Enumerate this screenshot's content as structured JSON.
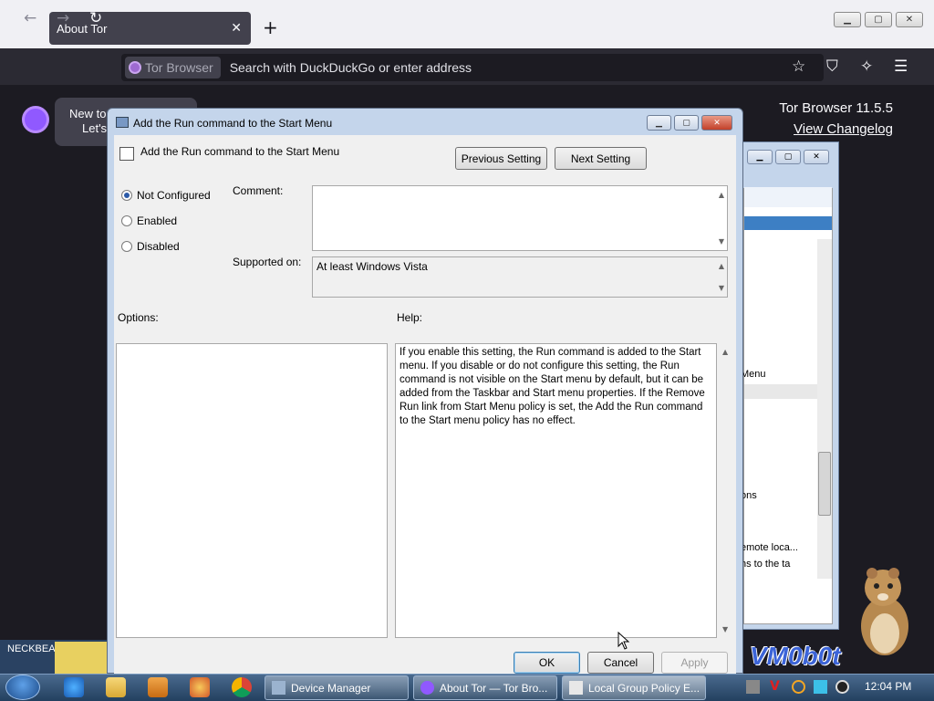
{
  "browser": {
    "tab_title": "About Tor",
    "tor_chip": "Tor Browser",
    "url_placeholder": "Search with DuckDuckGo or enter address"
  },
  "tor_page": {
    "banner_line1": "New to",
    "banner_line2": "Let's",
    "version": "Tor Browser 11.5.5",
    "changelog": "View Changelog"
  },
  "dialog": {
    "title": "Add the Run command to the Start Menu",
    "setting_name": "Add the Run command to the Start Menu",
    "prev_button": "Previous Setting",
    "next_button": "Next Setting",
    "radios": [
      {
        "label": "Not Configured",
        "checked": true
      },
      {
        "label": "Enabled",
        "checked": false
      },
      {
        "label": "Disabled",
        "checked": false
      }
    ],
    "comment_label": "Comment:",
    "supported_label": "Supported on:",
    "supported_value": "At least Windows Vista",
    "options_label": "Options:",
    "help_label": "Help:",
    "help_text": "If you enable this setting, the Run command is added to the Start menu.  If you disable or do not configure this setting, the Run command is not visible on the Start menu by default, but it can be added from the Taskbar and Start menu properties. If the Remove Run link from Start Menu policy is set, the Add the Run command to the Start menu policy has no effect.",
    "ok": "OK",
    "cancel": "Cancel",
    "apply": "Apply"
  },
  "bg_window": {
    "items": [
      "Menu",
      "ons",
      "emote loca...",
      "ns to the ta"
    ]
  },
  "desktop": {
    "neck_label": "NECKBEA...",
    "watermark": "VM0b0t"
  },
  "taskbar": {
    "tasks": [
      "Device Manager",
      "About Tor — Tor Bro...",
      "Local Group Policy E..."
    ],
    "clock": "12:04 PM"
  }
}
